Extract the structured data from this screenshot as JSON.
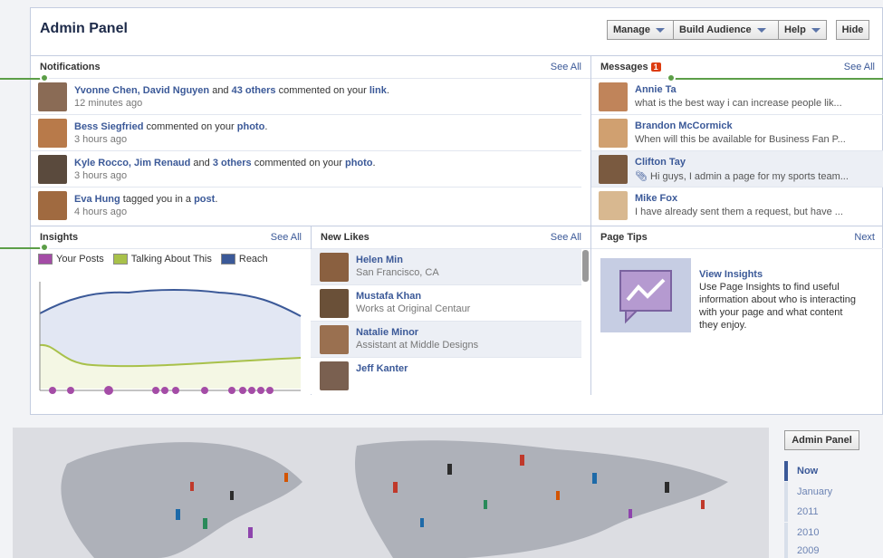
{
  "header": {
    "title": "Admin Panel",
    "manage": "Manage",
    "build_audience": "Build Audience",
    "help": "Help",
    "hide": "Hide"
  },
  "notifications": {
    "title": "Notifications",
    "see_all": "See All",
    "items": [
      {
        "l1": "Yvonne Chen, David Nguyen",
        "m1": " and ",
        "l2": "43 others",
        "m2": " commented on your ",
        "l3": "link",
        "end": ".",
        "time": "12 minutes ago"
      },
      {
        "l1": "Bess Siegfried",
        "m1": " commented on your ",
        "l2": "photo",
        "m2": ".",
        "l3": "",
        "end": "",
        "time": "3 hours ago"
      },
      {
        "l1": "Kyle Rocco, Jim Renaud",
        "m1": " and ",
        "l2": "3 others",
        "m2": " commented on your ",
        "l3": "photo",
        "end": ".",
        "time": "3 hours ago"
      },
      {
        "l1": "Eva Hung",
        "m1": " tagged you in a ",
        "l2": "post",
        "m2": ".",
        "l3": "",
        "end": "",
        "time": "4 hours ago"
      }
    ]
  },
  "messages": {
    "title": "Messages",
    "count": "1",
    "see_all": "See All",
    "items": [
      {
        "name": "Annie Ta",
        "preview": "what is the best way i can increase people lik..."
      },
      {
        "name": "Brandon McCormick",
        "preview": "When will this be available for Business Fan P..."
      },
      {
        "name": "Clifton Tay",
        "preview": "Hi guys, I admin a page for my sports team..."
      },
      {
        "name": "Mike Fox",
        "preview": "I have already sent them a request, but have ..."
      }
    ]
  },
  "insights": {
    "title": "Insights",
    "see_all": "See All",
    "legend": [
      "Your Posts",
      "Talking About This",
      "Reach"
    ],
    "colors": {
      "posts": "#a44ca6",
      "talking": "#a8c14a",
      "reach": "#3b5998"
    }
  },
  "new_likes": {
    "title": "New Likes",
    "see_all": "See All",
    "items": [
      {
        "name": "Helen Min",
        "sub": "San Francisco, CA"
      },
      {
        "name": "Mustafa Khan",
        "sub": "Works at Original Centaur"
      },
      {
        "name": "Natalie Minor",
        "sub": "Assistant at Middle Designs"
      },
      {
        "name": "Jeff Kanter",
        "sub": ""
      }
    ]
  },
  "page_tips": {
    "title": "Page Tips",
    "next": "Next",
    "link": "View Insights",
    "body": "Use Page Insights to find useful information about who is interacting with your page and what content they enjoy."
  },
  "timeline": {
    "admin_panel": "Admin Panel",
    "items": [
      "Now",
      "January",
      "2011",
      "2010",
      "2009"
    ]
  }
}
